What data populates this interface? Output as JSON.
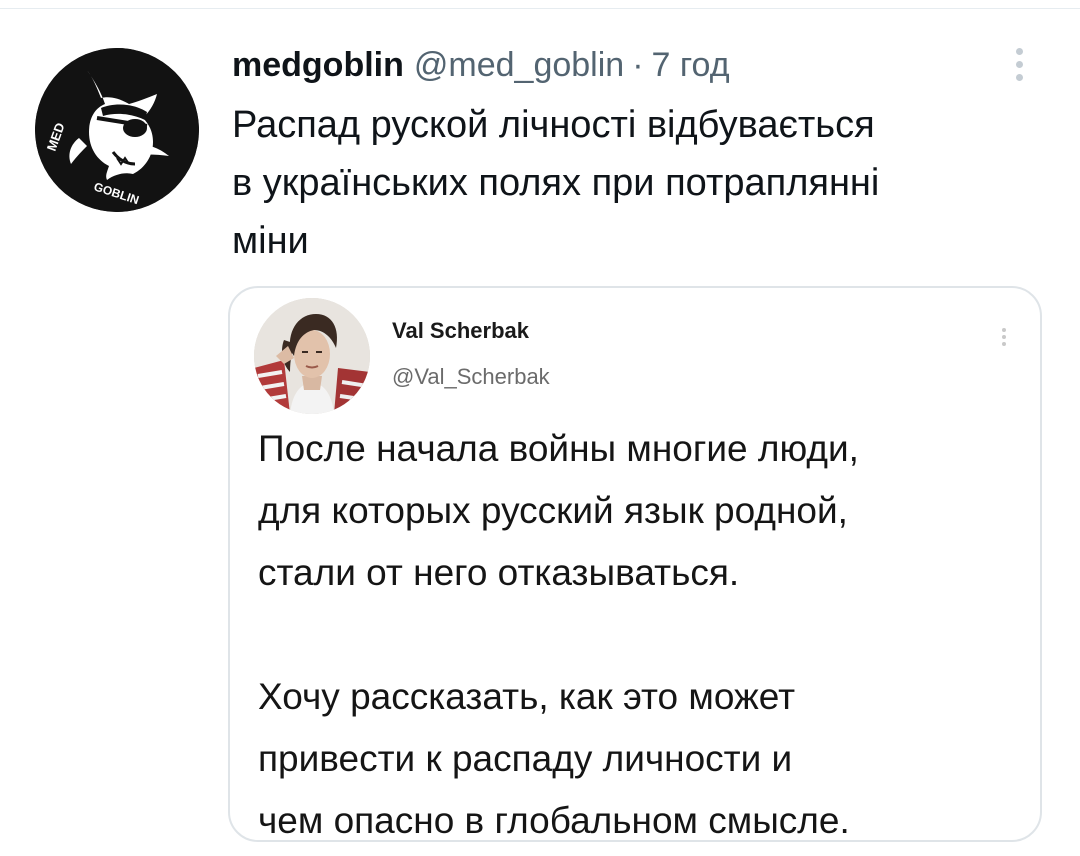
{
  "tweet": {
    "display_name": "medgoblin",
    "handle": "@med_goblin",
    "separator": "·",
    "time": "7 год",
    "text": "Распад руской лічності відбувається\nв українських полях при потраплянні\nміни",
    "avatar_text_top": "MED",
    "avatar_text_bottom": "GOBLIN"
  },
  "quoted_tweet": {
    "display_name": "Val Scherbak",
    "handle": "@Val_Scherbak",
    "text": "После начала войны многие люди,\nдля которых русский язык родной,\nстали от него отказываться.\n\nХочу рассказать, как это может\nпривести к распаду личности и\nчем опасно в глобальном смысле."
  },
  "icons": {
    "more": "more-vertical-icon",
    "quoted_more": "more-vertical-icon"
  },
  "colors": {
    "text_primary": "#0f1419",
    "text_secondary": "#536471",
    "card_border": "#dfe4e8",
    "avatar_bg": "#121212"
  }
}
